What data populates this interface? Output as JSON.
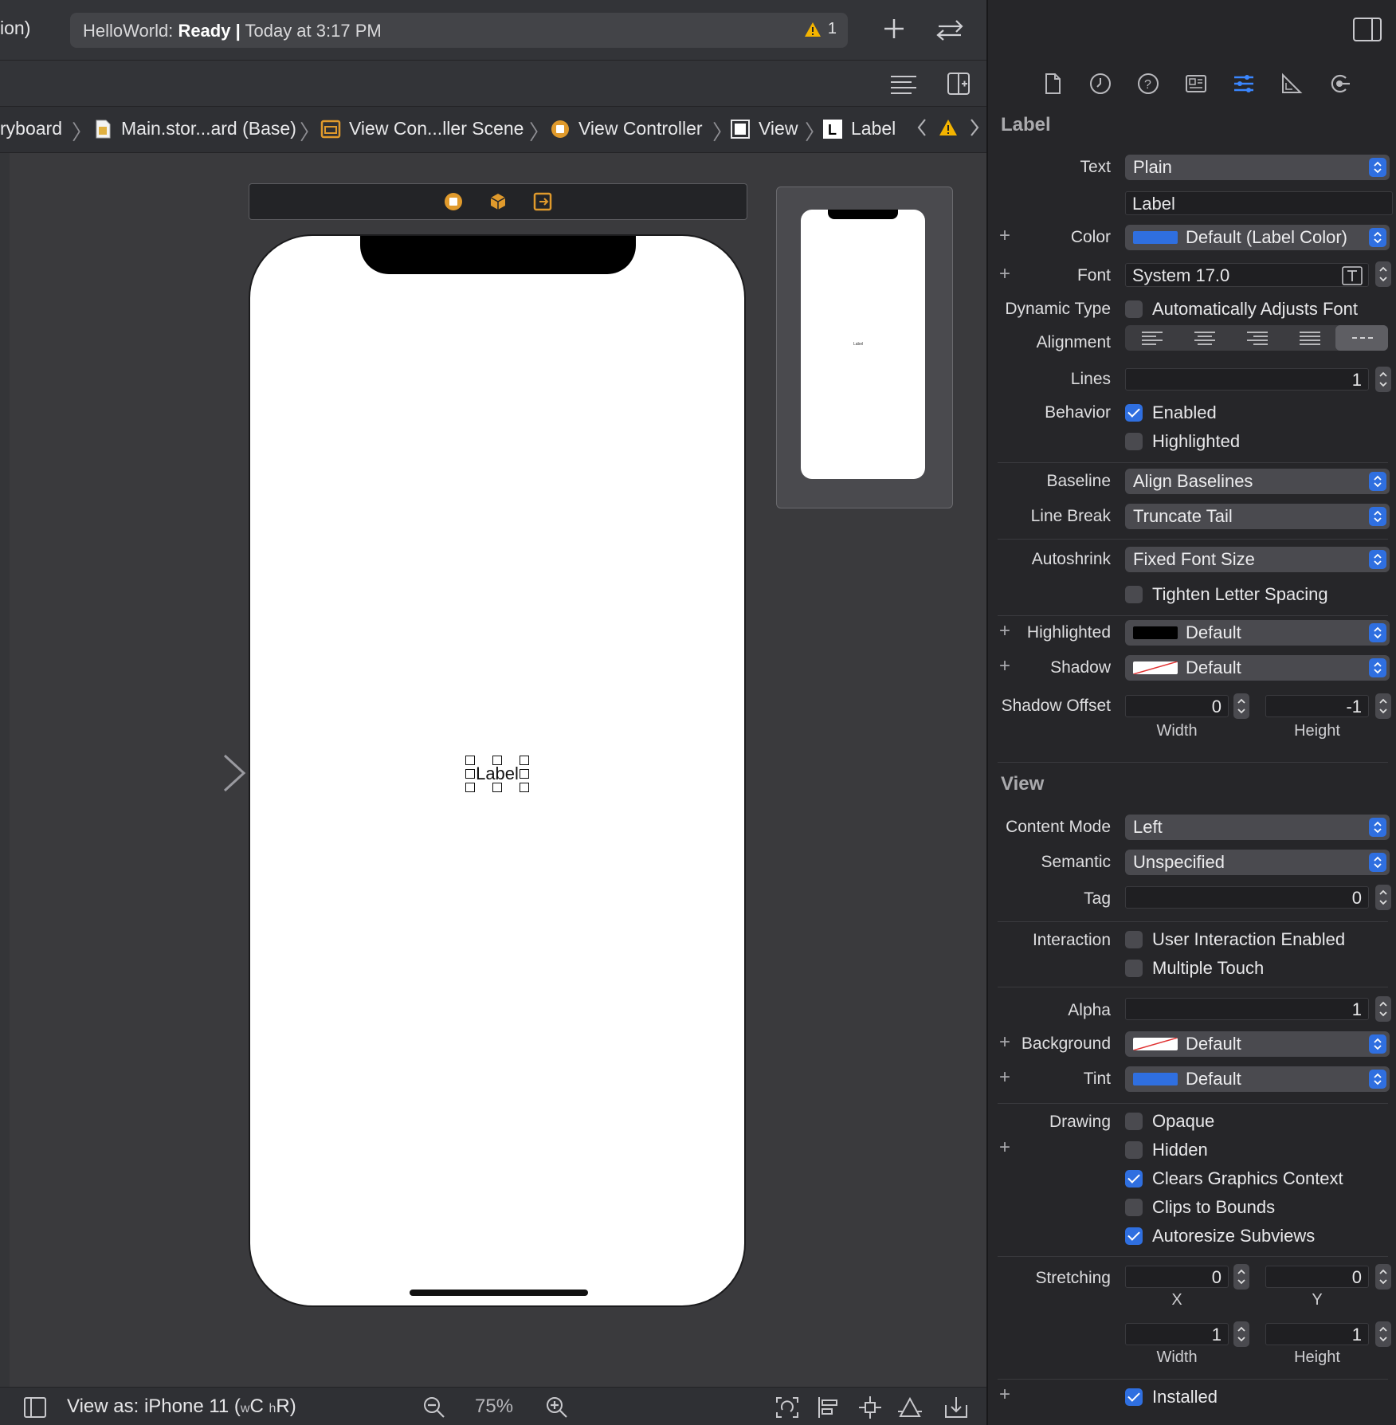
{
  "toolbar": {
    "left_text": "ion)",
    "status_project": "HelloWorld:",
    "status_state": "Ready",
    "status_sep": "|",
    "status_time": "Today at 3:17 PM",
    "warning_count": "1"
  },
  "breadcrumb": {
    "items": [
      {
        "label": "ryboard"
      },
      {
        "label": "Main.stor...ard (Base)"
      },
      {
        "label": "View Con...ller Scene"
      },
      {
        "label": "View Controller"
      },
      {
        "label": "View"
      },
      {
        "label": "Label"
      }
    ],
    "separator": "〉"
  },
  "canvas": {
    "label_text": "Label",
    "mini_label_text": "Label"
  },
  "bottombar": {
    "view_as_prefix": "View as: iPhone 11 (",
    "w_small": "w",
    "w_big": "C",
    "h_small": "h",
    "h_big": "R",
    "suffix": ")",
    "zoom": "75%"
  },
  "inspector": {
    "label_section": "Label",
    "text_label": "Text",
    "text_value": "Plain",
    "text_field": "Label",
    "color_label": "Color",
    "color_value": "Default (Label Color)",
    "font_label": "Font",
    "font_value": "System 17.0",
    "dynamic_type_label": "Dynamic Type",
    "dynamic_type_check": "Automatically Adjusts Font",
    "alignment_label": "Alignment",
    "lines_label": "Lines",
    "lines_value": "1",
    "behavior_label": "Behavior",
    "enabled": "Enabled",
    "highlighted_check": "Highlighted",
    "baseline_label": "Baseline",
    "baseline_value": "Align Baselines",
    "line_break_label": "Line Break",
    "line_break_value": "Truncate Tail",
    "autoshrink_label": "Autoshrink",
    "autoshrink_value": "Fixed Font Size",
    "tighten": "Tighten Letter Spacing",
    "highlighted_label": "Highlighted",
    "highlighted_value": "Default",
    "shadow_label": "Shadow",
    "shadow_value": "Default",
    "shadow_offset_label": "Shadow Offset",
    "shadow_offset_width": "0",
    "shadow_offset_height": "-1",
    "width_label": "Width",
    "height_label": "Height",
    "view_section": "View",
    "content_mode_label": "Content Mode",
    "content_mode_value": "Left",
    "semantic_label": "Semantic",
    "semantic_value": "Unspecified",
    "tag_label": "Tag",
    "tag_value": "0",
    "interaction_label": "Interaction",
    "user_interaction": "User Interaction Enabled",
    "multiple_touch": "Multiple Touch",
    "alpha_label": "Alpha",
    "alpha_value": "1",
    "background_label": "Background",
    "background_value": "Default",
    "tint_label": "Tint",
    "tint_value": "Default",
    "drawing_label": "Drawing",
    "opaque": "Opaque",
    "hidden": "Hidden",
    "clears_graphics": "Clears Graphics Context",
    "clips_bounds": "Clips to Bounds",
    "autoresize": "Autoresize Subviews",
    "stretching_label": "Stretching",
    "stretch_x": "0",
    "stretch_y": "0",
    "x_label": "X",
    "y_label": "Y",
    "stretch_w": "1",
    "stretch_h": "1",
    "installed": "Installed"
  },
  "colors": {
    "accent": "#2f6fe0",
    "warning": "#f4b400",
    "scene_icon": "#e09a2c"
  }
}
